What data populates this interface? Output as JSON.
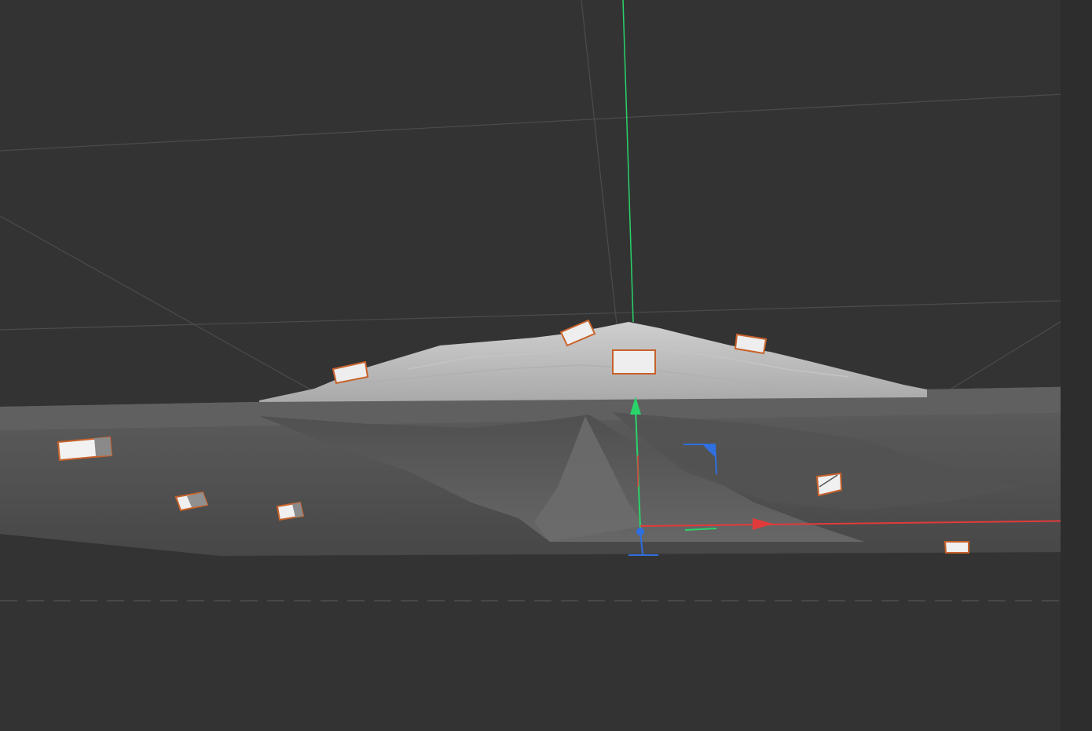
{
  "viewport": {
    "background_color": "#333333",
    "grid_line_color": "#4a4a4a",
    "axis_colors": {
      "x": "#e23a3a",
      "y": "#29d36a",
      "z": "#2f6fe0"
    },
    "camera_outline_color": "#c8622b",
    "camera_face_color": "#eeeeee",
    "terrain_colors": [
      "#b8b8b8",
      "#9a9a9a",
      "#5a5a5a",
      "#4a4a4a"
    ]
  },
  "gizmo": {
    "mode": "translate",
    "icons": [
      "move-y-arrow-icon",
      "move-x-arrow-icon",
      "move-z-handle-icon",
      "plane-xy-handle-icon",
      "rotate-handle-icon"
    ]
  }
}
